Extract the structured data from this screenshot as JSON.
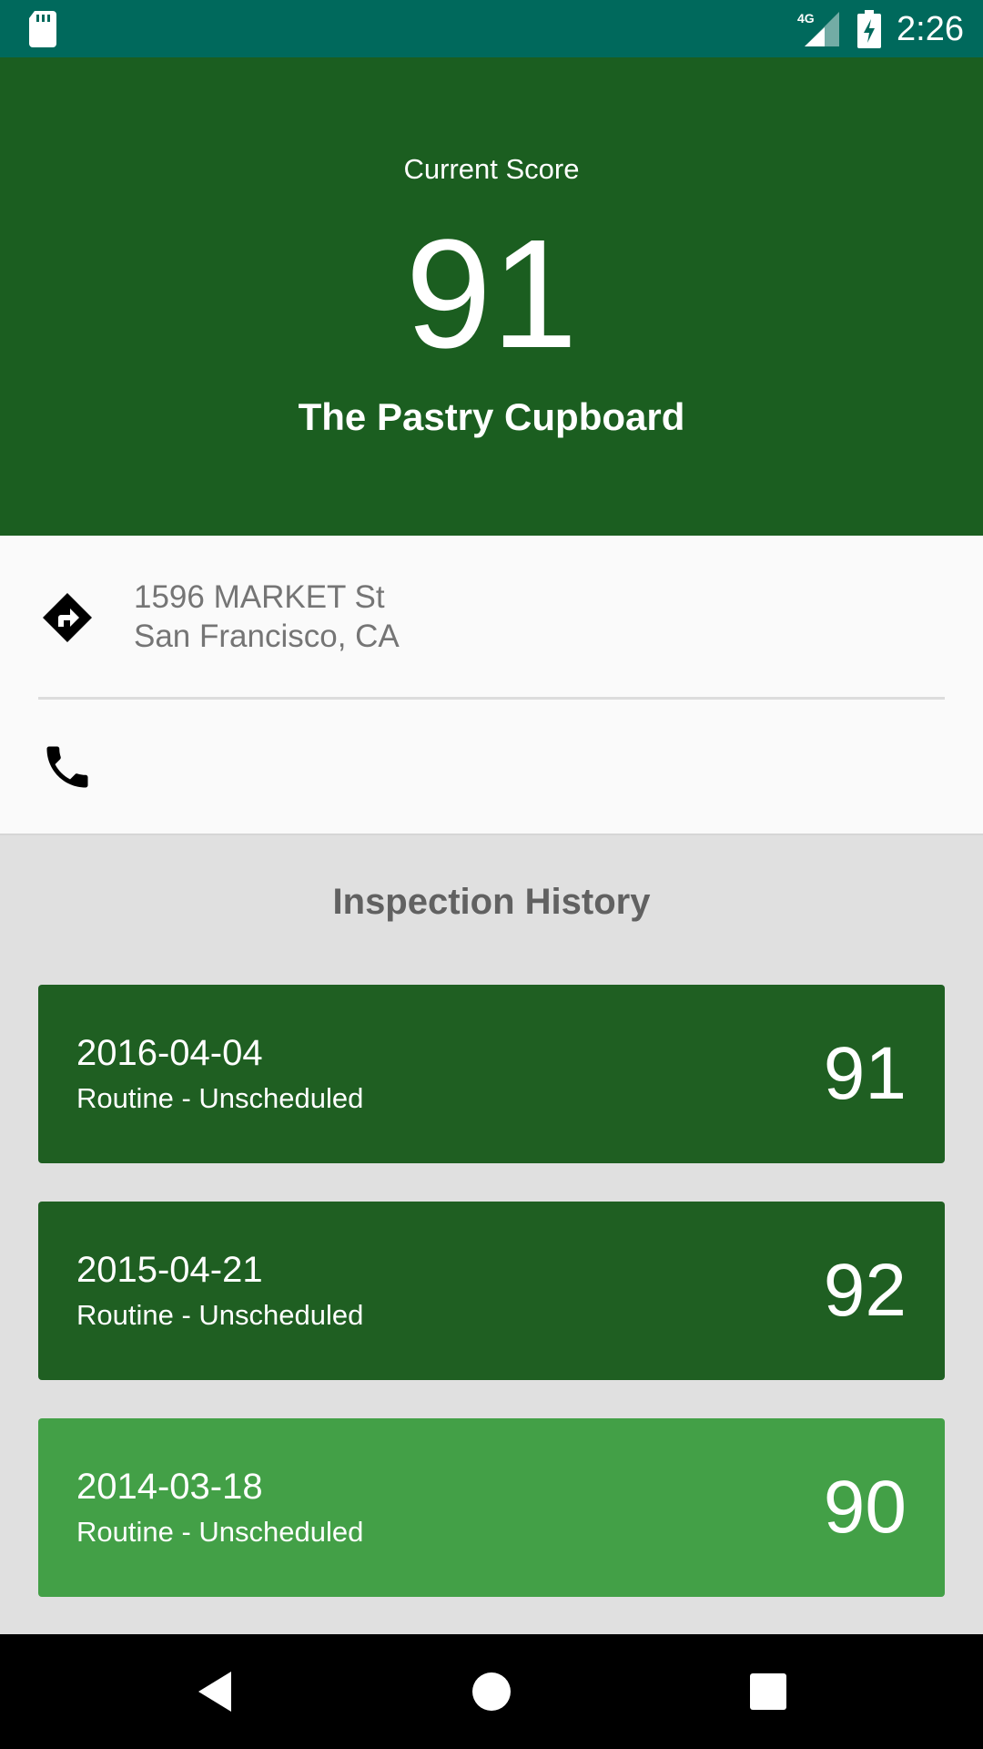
{
  "status_bar": {
    "time": "2:26",
    "network": "4G",
    "icons": [
      "sd-card-icon",
      "signal-icon",
      "battery-charging-icon"
    ]
  },
  "header": {
    "caption": "Current Score",
    "score": "91",
    "restaurant_name": "The Pastry Cupboard"
  },
  "contact": {
    "address_line1": "1596 MARKET St",
    "address_line2": "San Francisco, CA",
    "icons": [
      "directions-icon",
      "phone-icon"
    ]
  },
  "history": {
    "title": "Inspection History",
    "items": [
      {
        "date": "2016-04-04",
        "type": "Routine - Unscheduled",
        "score": "91"
      },
      {
        "date": "2015-04-21",
        "type": "Routine - Unscheduled",
        "score": "92"
      },
      {
        "date": "2014-03-18",
        "type": "Routine - Unscheduled",
        "score": "90"
      }
    ]
  },
  "nav": {
    "icons": [
      "back-icon",
      "home-icon",
      "recents-icon"
    ]
  },
  "colors": {
    "status_bar": "#00695c",
    "header": "#1b5e20",
    "card_dark": "#1f5f22",
    "card_light": "#43a047",
    "background": "#e0e0e0"
  }
}
